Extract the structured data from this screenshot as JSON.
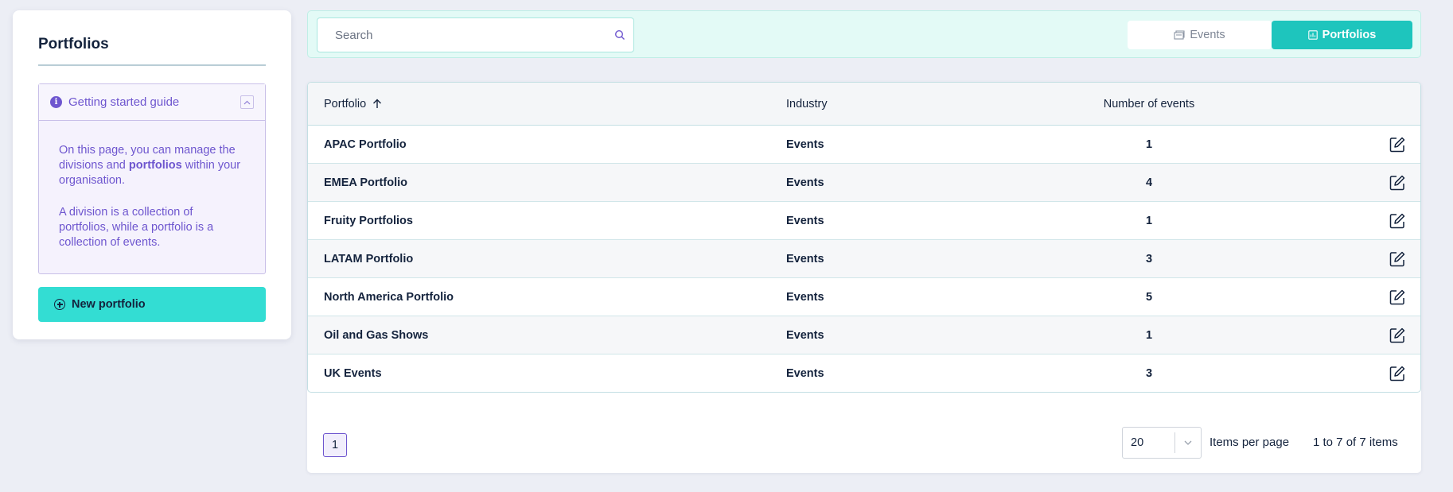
{
  "sidebar": {
    "title": "Portfolios",
    "guide": {
      "title": "Getting started guide",
      "para1_prefix": "On this page, you can manage the divisions and ",
      "para1_bold": "portfolios",
      "para1_suffix": " within your organisation.",
      "para2": "A division is a collection of portfolios, while a portfolio is a collection of events."
    },
    "new_button": "New portfolio"
  },
  "topbar": {
    "search_placeholder": "Search",
    "tabs": [
      {
        "label": "Events",
        "active": false
      },
      {
        "label": "Portfolios",
        "active": true
      }
    ]
  },
  "table": {
    "headers": [
      "Portfolio",
      "Industry",
      "Number of events"
    ],
    "rows": [
      {
        "portfolio": "APAC Portfolio",
        "industry": "Events",
        "events": "1"
      },
      {
        "portfolio": "EMEA Portfolio",
        "industry": "Events",
        "events": "4"
      },
      {
        "portfolio": "Fruity Portfolios",
        "industry": "Events",
        "events": "1"
      },
      {
        "portfolio": "LATAM Portfolio",
        "industry": "Events",
        "events": "3"
      },
      {
        "portfolio": "North America Portfolio",
        "industry": "Events",
        "events": "5"
      },
      {
        "portfolio": "Oil and Gas Shows",
        "industry": "Events",
        "events": "1"
      },
      {
        "portfolio": "UK Events",
        "industry": "Events",
        "events": "3"
      }
    ]
  },
  "pagination": {
    "current_page": "1",
    "per_page": "20",
    "per_page_label": "Items per page",
    "range": "1 to 7 of 7 items"
  },
  "colors": {
    "accent": "#6e56cf",
    "primary_button": "#33ddd3",
    "active_tab": "#1ec5bd"
  },
  "icons": [
    "info-icon",
    "chevron-up-icon",
    "plus-circle-icon",
    "search-icon",
    "events-icon",
    "chart-icon",
    "sort-arrow-up-icon",
    "edit-icon",
    "chevron-down-icon"
  ]
}
